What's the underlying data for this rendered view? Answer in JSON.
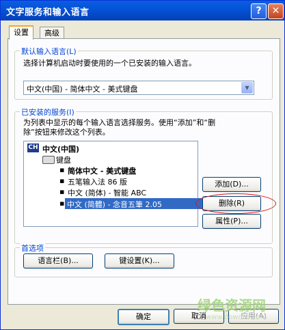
{
  "window": {
    "title": "文字服务和输入语言",
    "help_glyph": "?",
    "close_glyph": "✕"
  },
  "tabs": [
    {
      "label": "设置",
      "active": true
    },
    {
      "label": "高级",
      "active": false
    }
  ],
  "default_language": {
    "group_label": "默认输入语言(L)",
    "description": "选择计算机启动时要使用的一个已安装的输入语言。",
    "selected_value": "中文(中国) - 简体中文 - 美式键盘"
  },
  "installed_services": {
    "group_label": "已安装的服务(I)",
    "description_line1": "为列表中显示的每个输入语言选择服务。使用“添加”和“删",
    "description_line2": "除”按钮来修改这个列表。",
    "language_badge": "CH",
    "language_name": "中文(中国)",
    "category": "键盘",
    "items": [
      {
        "label": "简体中文 - 美式键盘",
        "bold": true,
        "selected": false
      },
      {
        "label": "五笔输入法 86 版",
        "bold": false,
        "selected": false
      },
      {
        "label": "中文 (简体) - 智能 ABC",
        "bold": false,
        "selected": false
      },
      {
        "label": "中文 (简體) - 念音五筆 2.05",
        "bold": false,
        "selected": true
      }
    ],
    "add_button": "添加(D)...",
    "remove_button": "删除(R)",
    "properties_button": "属性(P)..."
  },
  "preferences": {
    "group_label": "首选项",
    "language_bar_button": "语言栏(B)...",
    "key_settings_button": "键设置(K)..."
  },
  "footer": {
    "ok": "确定",
    "cancel": "取消",
    "apply": "应用(A)"
  },
  "watermark": {
    "text": "绿色资源网",
    "url": "www.downcc.com"
  }
}
